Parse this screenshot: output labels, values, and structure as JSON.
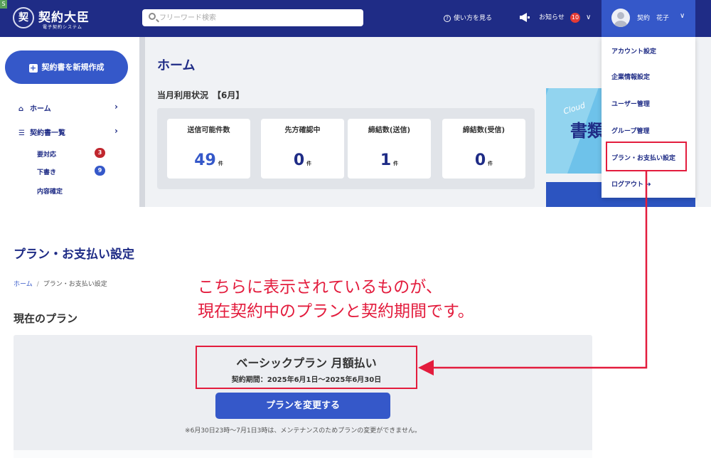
{
  "app": {
    "corner_badge": "S",
    "logo_mark": "契",
    "logo_name": "契約大臣",
    "logo_sub": "電子契約システム"
  },
  "header": {
    "search_placeholder": "フリーワード検索",
    "help_label": "使い方を見る",
    "notice_label": "お知らせ",
    "notice_count": "10",
    "user_name": "契約　花子"
  },
  "sidebar": {
    "new_contract_label": "契約書を新規作成",
    "items": [
      {
        "label": "ホーム",
        "icon": "home-icon"
      },
      {
        "label": "契約書一覧",
        "icon": "list-icon"
      }
    ],
    "sub_items": [
      {
        "label": "要対応",
        "count": "3",
        "count_color": "#c0262e"
      },
      {
        "label": "下書き",
        "count": "9",
        "count_color": "#3558c9"
      },
      {
        "label": "内容確定",
        "count": ""
      }
    ]
  },
  "home": {
    "title": "ホーム",
    "usage_title": "当月利用状況　【6月】",
    "stats": [
      {
        "label": "送信可能件数",
        "value": "49",
        "unit": "件",
        "color": "#3558c9"
      },
      {
        "label": "先方確認中",
        "value": "0",
        "unit": "件",
        "color": "#1f2c86"
      },
      {
        "label": "締結数(送信)",
        "value": "1",
        "unit": "件",
        "color": "#1f2c86"
      },
      {
        "label": "締結数(受信)",
        "value": "0",
        "unit": "件",
        "color": "#1f2c86"
      }
    ],
    "banner_tag": "Cloud",
    "banner_big": "書類"
  },
  "dropdown": {
    "items": [
      "アカウント設定",
      "企業情報設定",
      "ユーザー管理",
      "グループ管理",
      "プラン・お支払い設定",
      "ログアウト"
    ]
  },
  "plan_page": {
    "title": "プラン・お支払い設定",
    "breadcrumb": [
      "ホーム",
      "プラン・お支払い設定"
    ],
    "current_plan_heading": "現在のプラン",
    "plan_name": "ベーシックプラン 月額払い",
    "period": "契約期間：2025年6月1日〜2025年6月30日",
    "change_button": "プランを変更する",
    "maintenance_note": "※6月30日23時〜7月1日3時は、メンテナンスのためプランの変更ができません。"
  },
  "annotation": {
    "line1": "こちらに表示されているものが、",
    "line2": "現在契約中のプランと契約期間です。",
    "color": "#e31c3d"
  }
}
